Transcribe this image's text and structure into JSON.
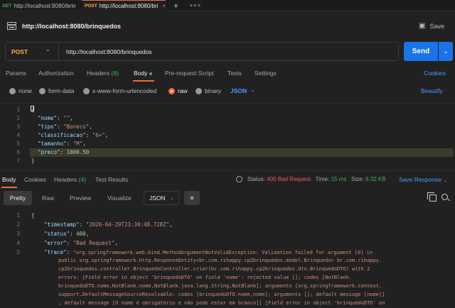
{
  "tabs": [
    {
      "method": "GET",
      "url": "http://localhost:8080/brin",
      "method_color": "#4caf50"
    },
    {
      "method": "POST",
      "url": "http://localhost:8080/bri",
      "method_color": "#fdb53a"
    }
  ],
  "tab_new": "+",
  "tab_more": "∘∘∘",
  "title": "http://localhost:8080/brinquedos",
  "save_label": "Save",
  "request": {
    "method": "POST",
    "url": "http://localhost:8080/brinquedos",
    "send_label": "Send"
  },
  "req_tabs": {
    "params": "Params",
    "authorization": "Authorization",
    "headers": "Headers",
    "headers_count": "(8)",
    "body": "Body",
    "prerequest": "Pre-request Script",
    "tests": "Tests",
    "settings": "Settings",
    "cookies": "Cookies"
  },
  "body_types": {
    "none": "none",
    "form_data": "form-data",
    "urlencoded": "x-www-form-urlencoded",
    "raw": "raw",
    "binary": "binary",
    "format": "JSON",
    "beautify": "Beautify"
  },
  "request_body": {
    "line_numbers": [
      "1",
      "2",
      "3",
      "4",
      "5",
      "6",
      "7"
    ],
    "lines": [
      {
        "key": "\"nome\"",
        "value": "\"\"",
        "sep": ","
      },
      {
        "key": "\"tipo\"",
        "value": "\"Boneco\"",
        "sep": ","
      },
      {
        "key": "\"classificacao\"",
        "value": "\"6+\"",
        "sep": ","
      },
      {
        "key": "\"tamanho\"",
        "value": "\"M\"",
        "sep": ","
      },
      {
        "key": "\"preco\"",
        "value": "1000.50",
        "sep": ""
      }
    ]
  },
  "response": {
    "tabs": {
      "body": "Body",
      "cookies": "Cookies",
      "headers": "Headers",
      "headers_count": "(4)",
      "test_results": "Test Results"
    },
    "status_label": "Status:",
    "status_value": "400 Bad Request",
    "time_label": "Time:",
    "time_value": "15 ms",
    "size_label": "Size:",
    "size_value": "6.32 KB",
    "save_response": "Save Response",
    "views": {
      "pretty": "Pretty",
      "raw": "Raw",
      "preview": "Preview",
      "visualize": "Visualize",
      "format": "JSON"
    },
    "line_numbers": [
      "1",
      "2",
      "3",
      "4",
      "5"
    ],
    "timestamp_key": "\"timestamp\"",
    "timestamp_value": "\"2026-04-29T23:30:48.728Z\"",
    "status_key": "\"status\"",
    "status_num": "400",
    "error_key": "\"error\"",
    "error_value": "\"Bad Request\"",
    "trace_key": "\"trace\"",
    "trace_lines": [
      "\"org.springframework.web.bind.MethodArgumentNotValidException: Validation failed for argument [0] in",
      "public org.springframework.http.ResponseEntity<br.com.rihappy.cp2brinquedos.model.Brinquedo> br.com.rihappy.",
      "cp2brinquedos.controller.BrinquedoController.criar(br.com.rihappy.cp2brinquedos.dto.BrinquedoDTO) with 2",
      "errors: [Field error in object 'brinquedoDTO' on field 'nome': rejected value []; codes [NotBlank.",
      "brinquedoDTO.nome,NotBlank.nome,NotBlank.java.lang.String,NotBlank]; arguments [org.springframework.context.",
      "support.DefaultMessageSourceResolvable: codes [brinquedoDTO.nome,nome]; arguments []; default message [nome]]",
      "; default message [O nome é obrigatório e não pode estar em branco]] [Field error in object 'brinquedoDTO' on"
    ]
  }
}
